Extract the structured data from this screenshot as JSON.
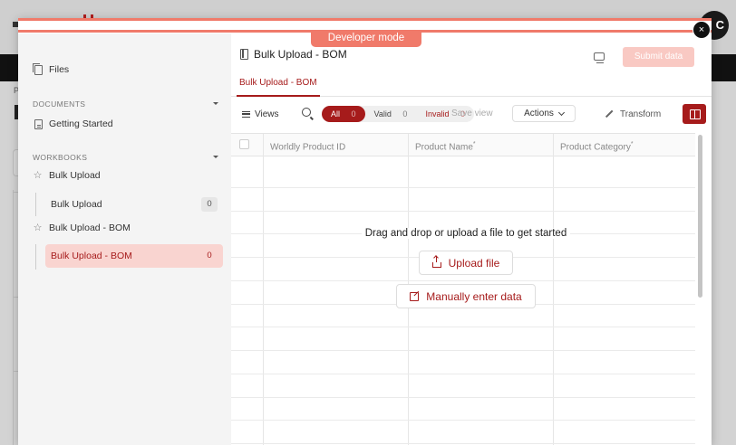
{
  "background": {
    "avatar_text": "C",
    "crumb": "P"
  },
  "modal": {
    "developer_badge": "Developer mode",
    "close_glyph": "×"
  },
  "sidebar": {
    "files_label": "Files",
    "documents_heading": "DOCUMENTS",
    "documents": [
      {
        "label": "Getting Started"
      }
    ],
    "workbooks_heading": "WORKBOOKS",
    "workbooks": [
      {
        "label": "Bulk Upload",
        "sheets": [
          {
            "label": "Bulk Upload",
            "count": "0"
          }
        ]
      },
      {
        "label": "Bulk Upload - BOM",
        "sheets": [
          {
            "label": "Bulk Upload - BOM",
            "count": "0",
            "active": true
          }
        ]
      }
    ]
  },
  "main": {
    "title": "Bulk Upload - BOM",
    "submit_label": "Submit data",
    "tabs": [
      {
        "label": "Bulk Upload - BOM",
        "active": true
      }
    ],
    "toolbar": {
      "views_label": "Views",
      "filter_all": "All",
      "filter_all_count": "0",
      "filter_valid": "Valid",
      "filter_valid_count": "0",
      "filter_invalid": "Invalid",
      "filter_invalid_count": "0",
      "save_view_label": "Save view",
      "actions_label": "Actions",
      "transform_label": "Transform"
    },
    "grid": {
      "columns": [
        {
          "label": "Worldly Product ID",
          "required": ""
        },
        {
          "label": "Product Name",
          "required": "*"
        },
        {
          "label": "Product Category",
          "required": "*"
        }
      ],
      "empty_message": "Drag and drop or upload a file to get started",
      "upload_label": "Upload file",
      "manual_label": "Manually enter data"
    }
  },
  "colors": {
    "accent": "#a61b1b",
    "accent_light": "#f9d4d0",
    "dev_banner": "#f07a6a"
  }
}
